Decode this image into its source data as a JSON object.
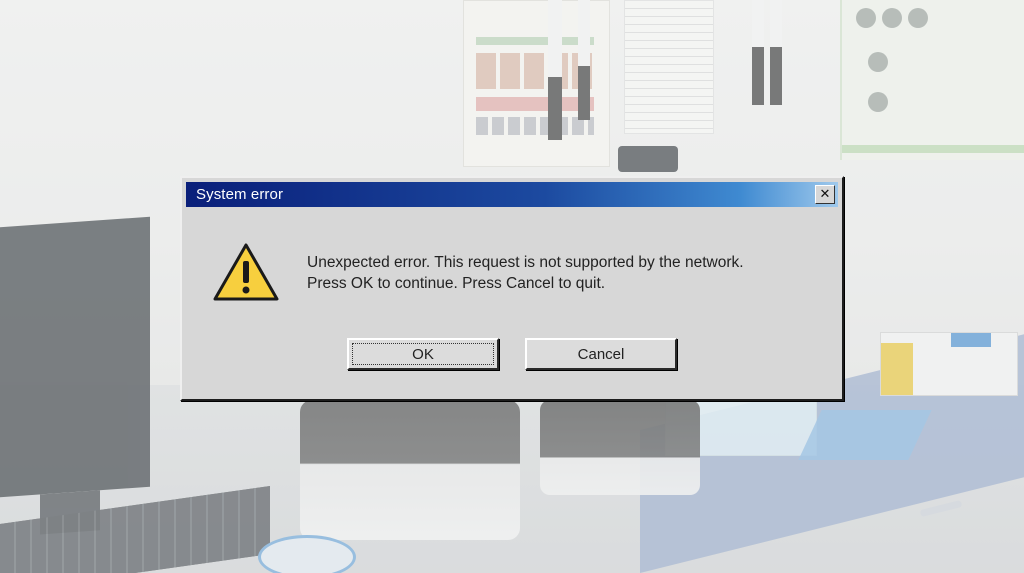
{
  "dialog": {
    "title": "System error",
    "close_label": "✕",
    "message_lines": [
      "Unexpected error. This request is not supported by the network.",
      "Press OK to continue. Press Cancel to quit."
    ],
    "icon": "warning-triangle-icon",
    "buttons": {
      "ok_label": "OK",
      "cancel_label": "Cancel"
    }
  },
  "colors": {
    "titlebar_start": "#0a1f7a",
    "titlebar_end": "#9fc9ec",
    "dialog_face": "#d7d7d7",
    "warning_fill": "#f7cf3e"
  }
}
